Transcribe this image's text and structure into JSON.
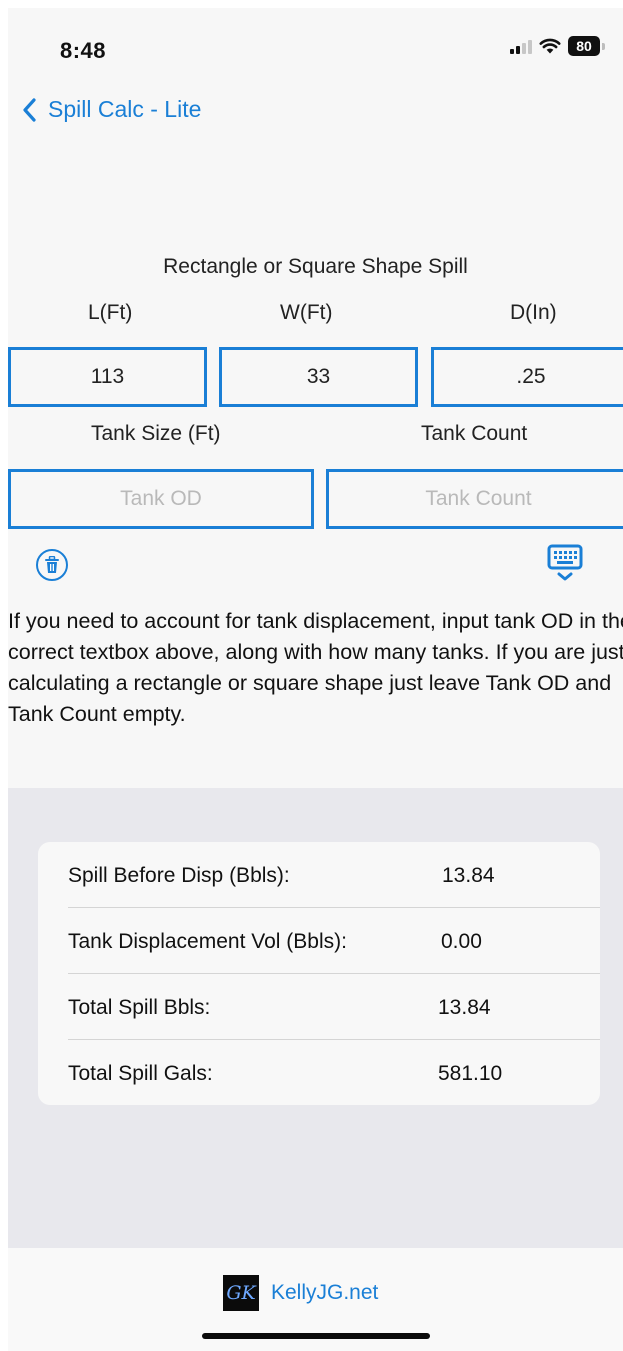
{
  "status": {
    "time": "8:48",
    "battery": "80"
  },
  "nav": {
    "back_label": "Spill Calc - Lite"
  },
  "form": {
    "title": "Rectangle or Square Shape Spill",
    "length_label": "L(Ft)",
    "width_label": "W(Ft)",
    "depth_label": "D(In)",
    "length_value": "113",
    "width_value": "33",
    "depth_value": ".25",
    "tank_size_label": "Tank Size (Ft)",
    "tank_count_label": "Tank Count",
    "tank_od_placeholder": "Tank OD",
    "tank_count_placeholder": "Tank Count"
  },
  "icons": {
    "clear": "trash-icon",
    "keyboard": "keyboard-icon",
    "accent": "#1a7fd6"
  },
  "info_text": "If you need to account for tank displacement, input tank OD in the correct textbox above, along with how many tanks.  If you are just calculating a rectangle or square shape just leave Tank OD and Tank Count empty.",
  "results": [
    {
      "label": "Spill Before Disp (Bbls):",
      "value": "13.84"
    },
    {
      "label": "Tank Displacement Vol (Bbls):",
      "value": "0.00"
    },
    {
      "label": "Total Spill Bbls:",
      "value": "13.84"
    },
    {
      "label": "Total Spill Gals:",
      "value": "581.10"
    }
  ],
  "footer": {
    "logo_text": "GK",
    "link": "KellyJG.net"
  }
}
